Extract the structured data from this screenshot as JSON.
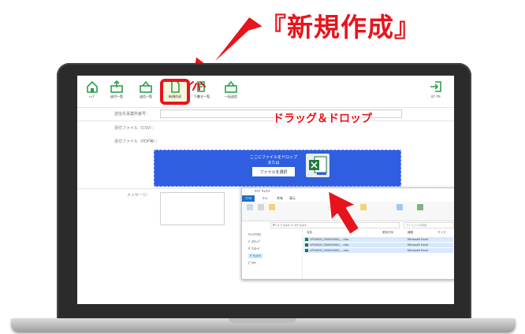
{
  "callout": {
    "title": "『新規作成』"
  },
  "toolbar": {
    "items": [
      {
        "label": "ﾄｯﾌﾟ",
        "icon": "home-icon"
      },
      {
        "label": "送付一覧",
        "icon": "send-list-icon"
      },
      {
        "label": "送信一覧",
        "icon": "outbox-icon"
      },
      {
        "label": "新規作成",
        "icon": "new-document-icon"
      },
      {
        "label": "下書き一覧",
        "icon": "drafts-icon"
      },
      {
        "label": "一括送信",
        "icon": "bulk-send-icon"
      }
    ],
    "logout": "ﾛｸﾞｱｳﾄ"
  },
  "form": {
    "sender_label": "送信先事業所番号：",
    "csv_label": "添付ファイル（CSV）：",
    "pdf_label": "添付ファイル（PDF等）：",
    "message_label": "メッセージ："
  },
  "dropzone": {
    "line1": "ここにファイルをドロップ",
    "line2": "または",
    "button": "ファイルを選択"
  },
  "explorer": {
    "title": "ﾏｲﾄﾞｷｭﾒﾝﾄ",
    "tabs": [
      "ﾌｧｲﾙ",
      "ﾎｰﾑ",
      "共有",
      "表示"
    ],
    "path": "PC > ﾄﾞｷｭﾒﾝﾄ > ﾏｲﾄﾞｷｭﾒﾝﾄ",
    "search": "ﾏｲﾄﾞｷｭﾒﾝﾄの検索",
    "sidebar": [
      "ｸｲｯｸｱｸｾｽ",
      "ﾃﾞｽｸﾄｯﾌﾟ",
      "ﾀﾞｳﾝﾛｰﾄﾞ",
      "ﾄﾞｷｭﾒﾝﾄ",
      "ﾋﾟｸﾁｬ"
    ],
    "columns": [
      "名前",
      "更新日時",
      "種類",
      "サイズ"
    ],
    "files": [
      {
        "name": "UFS0000_000000000_...xlsx",
        "type": "Microsoft Excel"
      },
      {
        "name": "UFS0000_000000000_...xlsx",
        "type": "Microsoft Excel"
      },
      {
        "name": "UFS0000_000000000_...xlsx",
        "type": "Microsoft Excel"
      }
    ]
  },
  "annotation": {
    "drag_drop": "ドラッグ＆ドロップ"
  },
  "colors": {
    "accent_red": "#e8141b",
    "brand_green": "#2aa14b",
    "dropzone_blue": "#2f5fe0"
  }
}
